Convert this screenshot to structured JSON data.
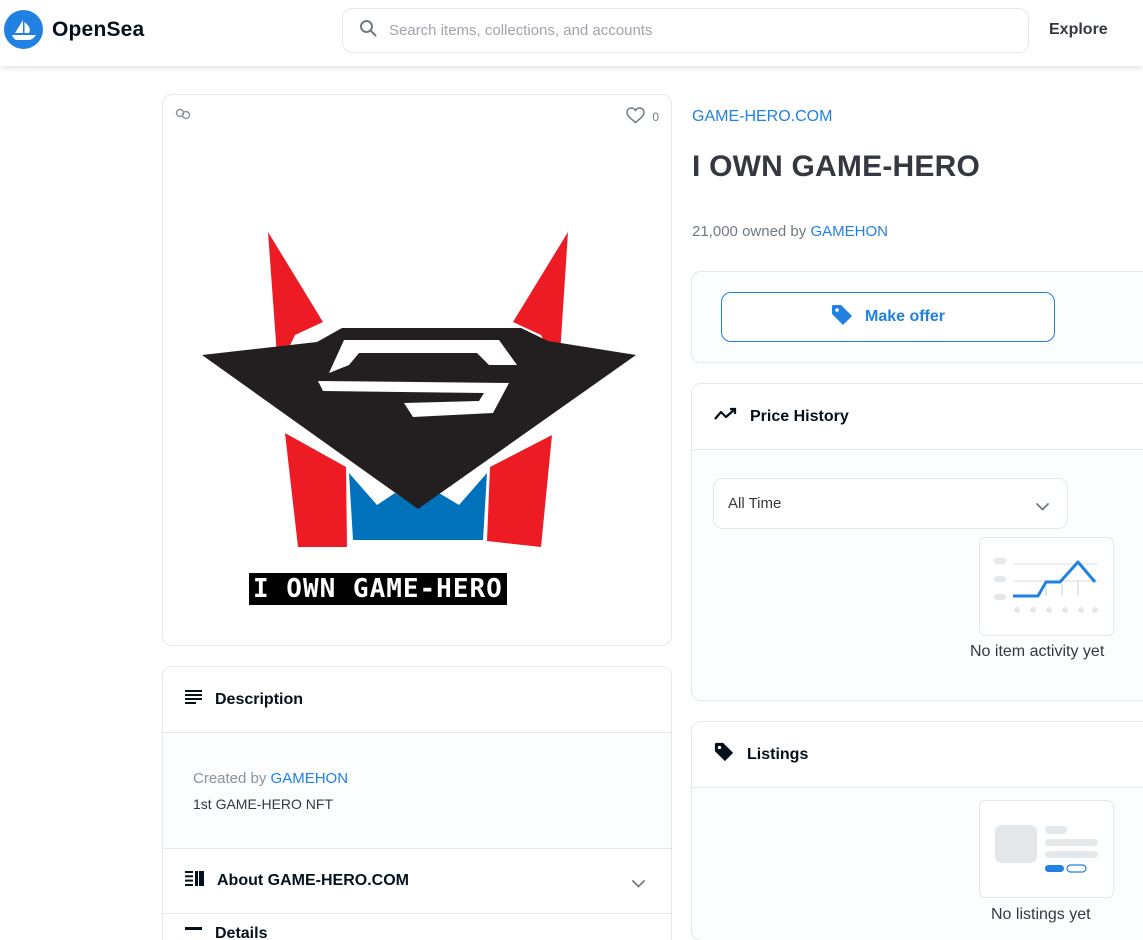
{
  "header": {
    "brand": "OpenSea",
    "search_placeholder": "Search items, collections, and accounts",
    "nav_explore": "Explore"
  },
  "media": {
    "favorites_count": "0",
    "artwork_caption": "I OWN GAME-HERO"
  },
  "description_panel": {
    "title": "Description",
    "created_by_prefix": "Created by",
    "creator": "GAMEHON",
    "text": "1st GAME-HERO NFT"
  },
  "about_panel": {
    "title": "About GAME-HERO.COM"
  },
  "details_panel": {
    "title": "Details"
  },
  "item": {
    "collection": "GAME-HERO.COM",
    "title": "I OWN GAME-HERO",
    "owned_count": "21,000",
    "owned_by_label": "owned by",
    "owner": "GAMEHON"
  },
  "offer": {
    "button_label": "Make offer"
  },
  "price_history": {
    "title": "Price History",
    "range_selected": "All Time",
    "empty_text": "No item activity yet"
  },
  "listings": {
    "title": "Listings",
    "empty_text": "No listings yet"
  },
  "colors": {
    "accent": "#2081e2",
    "text_dark": "#04111d",
    "text_body": "#353840",
    "art_red": "#ed1c24",
    "art_black": "#231f20",
    "art_blue": "#0072bc"
  }
}
